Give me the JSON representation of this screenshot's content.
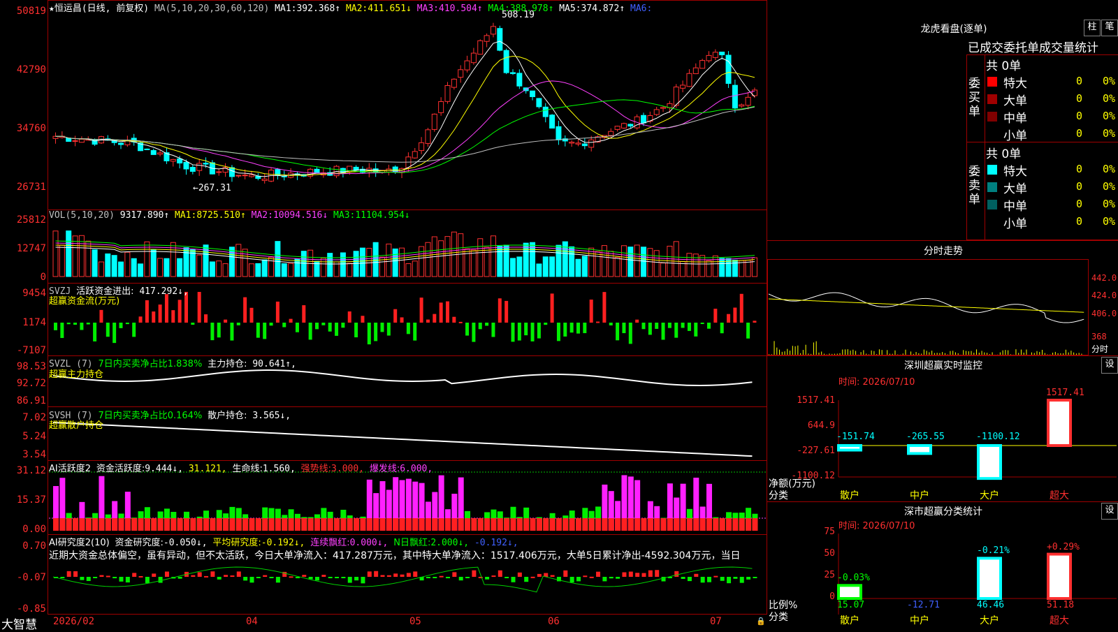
{
  "app": {
    "brand": "大智慧"
  },
  "stock": {
    "name": "★恒运昌(日线, 前复权)",
    "ma_label": "MA(5,10,20,30,60,120)",
    "ma1_label": "MA1:",
    "ma1": "392.368↑",
    "ma2_label": "MA2:",
    "ma2": "411.651↓",
    "ma3_label": "MA3:",
    "ma3": "410.504↑",
    "ma4_label": "MA4:",
    "ma4": "388.978↑",
    "ma5_label": "MA5:",
    "ma5": "374.872↑",
    "ma6_label": "MA6:",
    "high_mark": "508.19",
    "low_mark": "←267.31"
  },
  "price_axis": [
    "50819",
    "42790",
    "34760",
    "26731"
  ],
  "vol": {
    "label": "VOL(5,10,20)",
    "value": "9317.890↑",
    "ma1_label": "MA1:",
    "ma1": "8725.510↑",
    "ma2_label": "MA2:",
    "ma2": "10094.516↓",
    "ma3_label": "MA3:",
    "ma3": "11104.954↓",
    "axis": [
      "25812",
      "12747",
      "0"
    ]
  },
  "svzj": {
    "label": "SVZJ",
    "title": "活跃资金进出:",
    "value": "417.292↓,",
    "sub": "超赢资金流(万元)",
    "axis": [
      "9454",
      "1174",
      "-7107"
    ]
  },
  "svzl": {
    "label": "SVZL (7)",
    "pct": "7日内买卖净占比1.838%",
    "hold_label": "主力持仓:",
    "hold": "90.641↑,",
    "sub": "超赢主力持仓",
    "axis": [
      "98.53",
      "92.72",
      "86.91"
    ]
  },
  "svsh": {
    "label": "SVSH (7)",
    "pct": "7日内买卖净占比0.164%",
    "hold_label": "散户持仓:",
    "hold": "3.565↓,",
    "sub": "超赢散户持仓",
    "axis": [
      "7.02",
      "5.24",
      "3.54"
    ]
  },
  "ai1": {
    "label": "AI活跃度2",
    "a_label": "资金活跃度:",
    "a": "9.444↓,",
    "b": "31.121,",
    "c_label": "生命线:",
    "c": "1.560,",
    "d_label": "强势线:",
    "d": "3.000,",
    "e_label": "爆发线:",
    "e": "6.000,",
    "axis": [
      "31.12",
      "15.37",
      "0.00"
    ]
  },
  "ai2": {
    "label": "AI研究度2(10)",
    "a_label": "资金研究度:",
    "a": "-0.050↓,",
    "b_label": "平均研究度:",
    "b": "-0.192↓,",
    "c_label": "连续飘红:",
    "c": "0.000↓,",
    "d_label": "N日飘红:",
    "d": "2.000↓,",
    "e": "-0.192↓,",
    "comment": "近期大资金总体偏空，虽有异动，但不太活跃，今日大单净流入：417.287万元，其中特大单净流入：1517.406万元，大单5日累计净出-4592.304万元，当日",
    "axis": [
      "0.70",
      "-0.07",
      "-0.85"
    ]
  },
  "xaxis": [
    "2026/02",
    "04",
    "05",
    "06",
    "07"
  ],
  "sidebar": {
    "lhb_title": "龙虎看盘(逐单)",
    "btn_zhu": "柱",
    "btn_bi": "笔",
    "tabs": "已成交委托单成交量统计",
    "buy_label": "委买单",
    "sell_label": "委卖单",
    "buy_total": "共 0单",
    "sell_total": "共 0单",
    "buy_rows": [
      {
        "name": "特大",
        "n": "0",
        "p": "0%"
      },
      {
        "name": "大单",
        "n": "0",
        "p": "0%"
      },
      {
        "name": "中单",
        "n": "0",
        "p": "0%"
      },
      {
        "name": "小单",
        "n": "0",
        "p": "0%"
      }
    ],
    "sell_rows": [
      {
        "name": "特大",
        "n": "0",
        "p": "0%"
      },
      {
        "name": "大单",
        "n": "0",
        "p": "0%"
      },
      {
        "name": "中单",
        "n": "0",
        "p": "0%"
      },
      {
        "name": "小单",
        "n": "0",
        "p": "0%"
      }
    ],
    "colors": {
      "buy": [
        "#ff0000",
        "#a00000",
        "#800000",
        "#000000"
      ],
      "sell": [
        "#00ffff",
        "#008080",
        "#006060",
        "#000000"
      ]
    },
    "intraday_title": "分时走势",
    "intraday_axis": [
      "442.0",
      "424.0",
      "406.0",
      "368"
    ],
    "intraday_fen": "分时",
    "mon_title": "深圳超赢实时监控",
    "mon_btn": "设",
    "mon_time": "时间: 2026/07/10",
    "mon_axis": [
      "1517.41",
      "644.9",
      "-227.61",
      "-1100.12"
    ],
    "mon_unit": "净额(万元)",
    "mon_cat": "分类",
    "mon_bars": [
      {
        "cat": "散户",
        "val": -151.74,
        "label": "-151.74"
      },
      {
        "cat": "中户",
        "val": -265.55,
        "label": "-265.55"
      },
      {
        "cat": "大户",
        "val": -1100.12,
        "label": "-1100.12"
      },
      {
        "cat": "超大",
        "val": 1517.41,
        "label": "1517.41"
      }
    ],
    "cls_title": "深市超赢分类统计",
    "cls_btn": "设",
    "cls_time": "时间: 2026/07/10",
    "cls_axis": [
      "75",
      "50",
      "25",
      "0"
    ],
    "cls_unit": "比例%",
    "cls_cat": "分类",
    "cls_bars": [
      {
        "cat": "散户",
        "val": 15.07,
        "top": "-0.03%",
        "bottom": "15.07"
      },
      {
        "cat": "中户",
        "val": -12.71,
        "top": "",
        "bottom": "-12.71"
      },
      {
        "cat": "大户",
        "val": 46.46,
        "top": "-0.21%",
        "bottom": "46.46"
      },
      {
        "cat": "超大",
        "val": 51.18,
        "top": "+0.29%",
        "bottom": "51.18"
      }
    ]
  }
}
